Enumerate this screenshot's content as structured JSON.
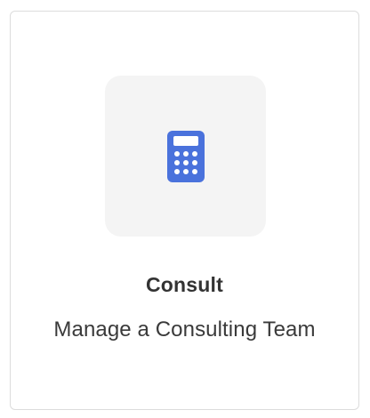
{
  "card": {
    "title": "Consult",
    "subtitle": "Manage a Consulting Team",
    "icon": "calculator-icon"
  },
  "colors": {
    "accent": "#4a72dc",
    "tile": "#f4f4f4",
    "border": "#dcdcdc"
  }
}
